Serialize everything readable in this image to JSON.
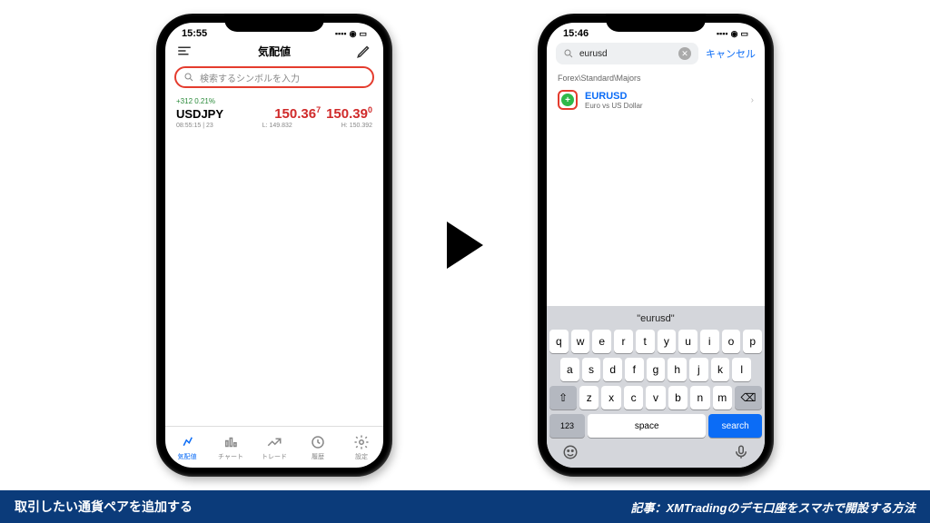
{
  "left": {
    "status": {
      "time": "15:55",
      "signal": "▪▪▪▪",
      "wifi": "◉",
      "battery": "▭"
    },
    "title": "気配値",
    "search_placeholder": "検索するシンボルを入力",
    "quote": {
      "change": "+312 0.21%",
      "symbol": "USDJPY",
      "bid_big": "150.36",
      "bid_sup": "7",
      "ask_big": "150.39",
      "ask_sup": "0",
      "time_spread": "08:55:15 | 23",
      "low": "L: 149.832",
      "high": "H: 150.392"
    },
    "tabs": [
      "気配値",
      "チャート",
      "トレード",
      "履歴",
      "設定"
    ]
  },
  "right": {
    "status": {
      "time": "15:46",
      "signal": "▪▪▪▪",
      "wifi": "◉",
      "battery": "▭"
    },
    "search_value": "eurusd",
    "cancel": "キャンセル",
    "section": "Forex\\Standard\\Majors",
    "result": {
      "symbol": "EURUSD",
      "desc": "Euro vs US Dollar"
    },
    "keyboard": {
      "suggestion": "\"eurusd\"",
      "rows": [
        [
          "q",
          "w",
          "e",
          "r",
          "t",
          "y",
          "u",
          "i",
          "o",
          "p"
        ],
        [
          "a",
          "s",
          "d",
          "f",
          "g",
          "h",
          "j",
          "k",
          "l"
        ],
        [
          "z",
          "x",
          "c",
          "v",
          "b",
          "n",
          "m"
        ]
      ],
      "shift": "⇧",
      "backspace": "⌫",
      "num": "123",
      "space": "space",
      "search": "search"
    }
  },
  "banner": {
    "left": "取引したい通貨ペアを追加する",
    "right": "記事：XMTradingのデモ口座をスマホで開設する方法"
  }
}
